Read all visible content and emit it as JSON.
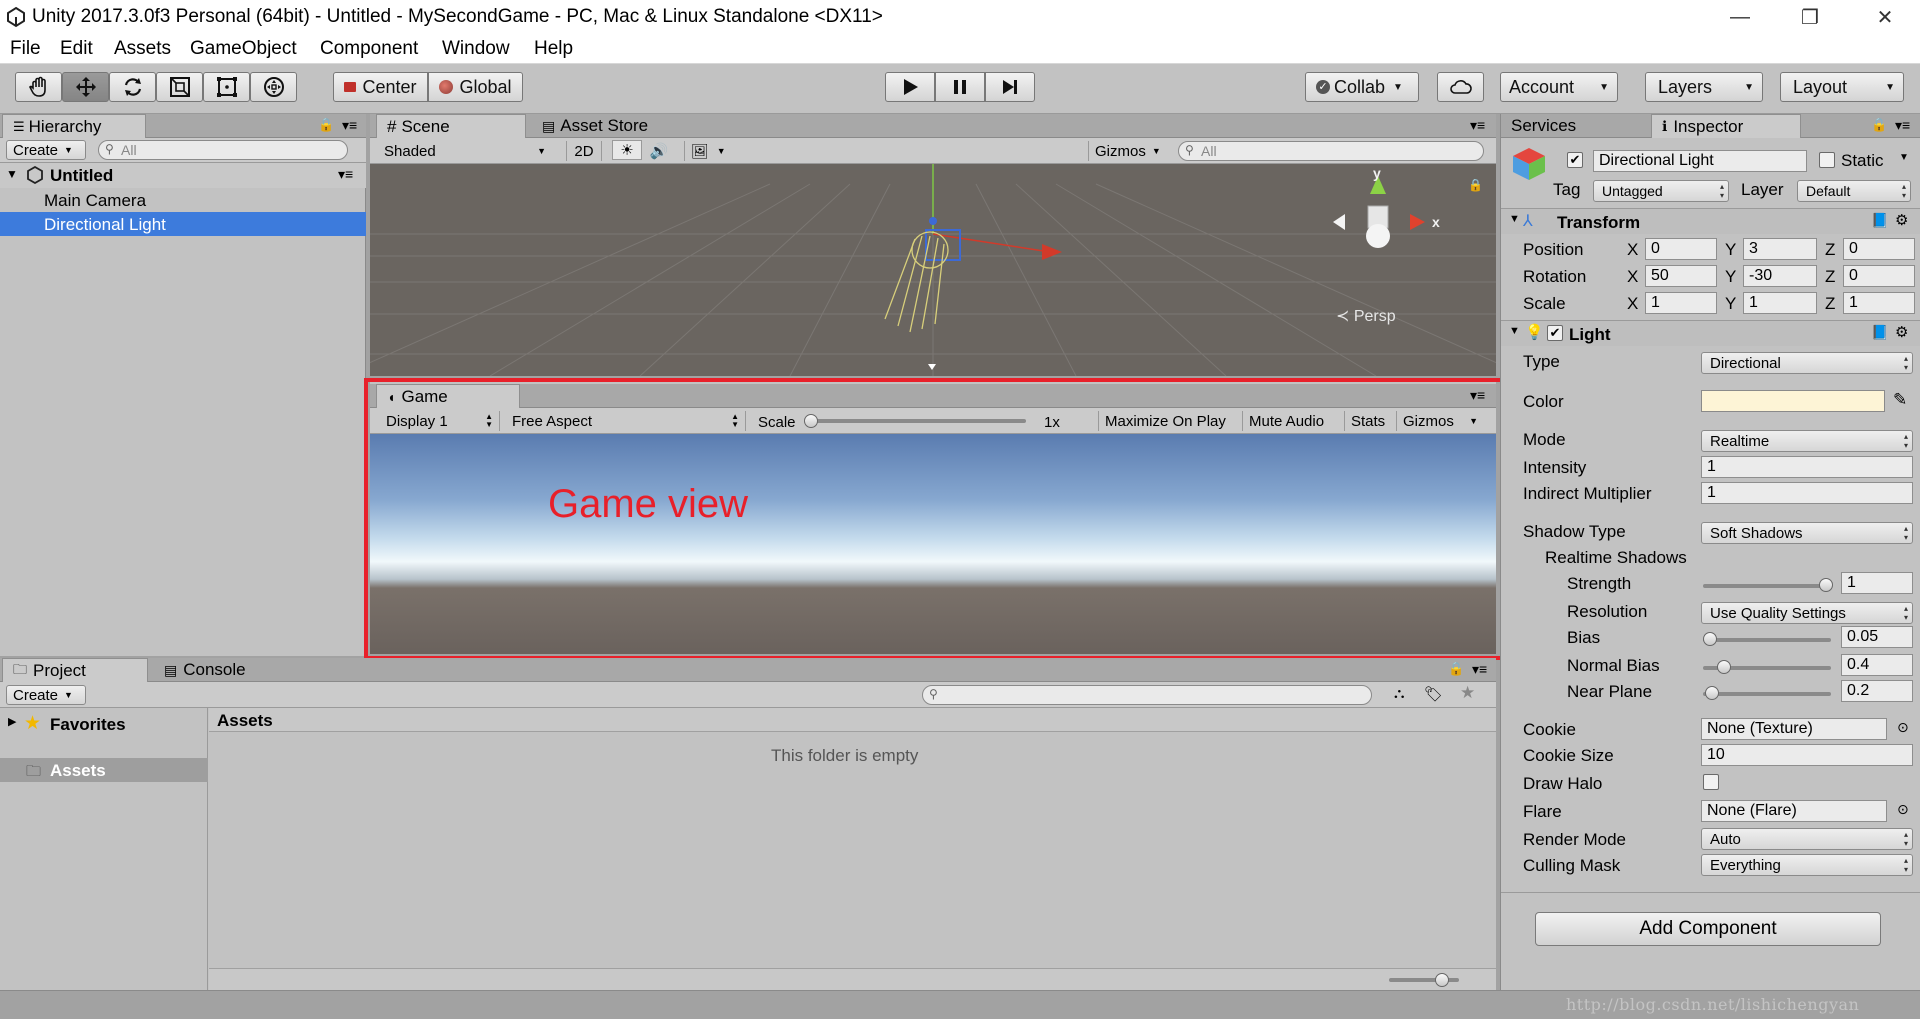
{
  "window": {
    "title": "Unity 2017.3.0f3 Personal (64bit) - Untitled - MySecondGame - PC, Mac & Linux Standalone <DX11>",
    "minimize": "—",
    "maximize": "❐",
    "close": "✕"
  },
  "menu": [
    "File",
    "Edit",
    "Assets",
    "GameObject",
    "Component",
    "Window",
    "Help"
  ],
  "toolbar": {
    "center_label": "Center",
    "global_label": "Global",
    "collab_label": "Collab",
    "account_label": "Account",
    "layers_label": "Layers",
    "layout_label": "Layout"
  },
  "hierarchy": {
    "tab": "Hierarchy",
    "create": "Create",
    "search_placeholder": "All",
    "scene_name": "Untitled",
    "items": [
      "Main Camera",
      "Directional Light"
    ]
  },
  "scene": {
    "tab": "Scene",
    "asset_store_tab": "Asset Store",
    "shading_mode": "Shaded",
    "mode_2d": "2D",
    "gizmos": "Gizmos",
    "search_placeholder": "All",
    "persp_label": "Persp",
    "axis_y": "y",
    "axis_x": "x"
  },
  "game": {
    "tab": "Game",
    "display": "Display 1",
    "aspect": "Free Aspect",
    "scale_label": "Scale",
    "scale_value": "1x",
    "maximize_on_play": "Maximize On Play",
    "mute_audio": "Mute Audio",
    "stats": "Stats",
    "gizmos": "Gizmos",
    "annotation": "Game view"
  },
  "project": {
    "project_tab": "Project",
    "console_tab": "Console",
    "create": "Create",
    "favorites": "Favorites",
    "assets_folder": "Assets",
    "assets_header": "Assets",
    "empty_message": "This folder is empty"
  },
  "inspector": {
    "services_tab": "Services",
    "inspector_tab": "Inspector",
    "object_name": "Directional Light",
    "static_label": "Static",
    "tag_label": "Tag",
    "tag_value": "Untagged",
    "layer_label": "Layer",
    "layer_value": "Default",
    "transform": {
      "title": "Transform",
      "position_label": "Position",
      "rotation_label": "Rotation",
      "scale_label": "Scale",
      "position": {
        "x": "0",
        "y": "3",
        "z": "0"
      },
      "rotation": {
        "x": "50",
        "y": "-30",
        "z": "0"
      },
      "scale": {
        "x": "1",
        "y": "1",
        "z": "1"
      }
    },
    "light": {
      "title": "Light",
      "type_label": "Type",
      "type_value": "Directional",
      "color_label": "Color",
      "color_value": "#fdf4d6",
      "mode_label": "Mode",
      "mode_value": "Realtime",
      "intensity_label": "Intensity",
      "intensity_value": "1",
      "indirect_label": "Indirect Multiplier",
      "indirect_value": "1",
      "shadow_type_label": "Shadow Type",
      "shadow_type_value": "Soft Shadows",
      "realtime_shadows_label": "Realtime Shadows",
      "strength_label": "Strength",
      "strength_value": "1",
      "resolution_label": "Resolution",
      "resolution_value": "Use Quality Settings",
      "bias_label": "Bias",
      "bias_value": "0.05",
      "normal_bias_label": "Normal Bias",
      "normal_bias_value": "0.4",
      "near_plane_label": "Near Plane",
      "near_plane_value": "0.2",
      "cookie_label": "Cookie",
      "cookie_value": "None (Texture)",
      "cookie_size_label": "Cookie Size",
      "cookie_size_value": "10",
      "draw_halo_label": "Draw Halo",
      "flare_label": "Flare",
      "flare_value": "None (Flare)",
      "render_mode_label": "Render Mode",
      "render_mode_value": "Auto",
      "culling_mask_label": "Culling Mask",
      "culling_mask_value": "Everything"
    },
    "add_component": "Add Component"
  },
  "watermark": "http://blog.csdn.net/lishichengyan",
  "colors": {
    "selection": "#3d7bdc",
    "highlight_border": "#e8202a",
    "annotation_text": "#e8202a"
  }
}
